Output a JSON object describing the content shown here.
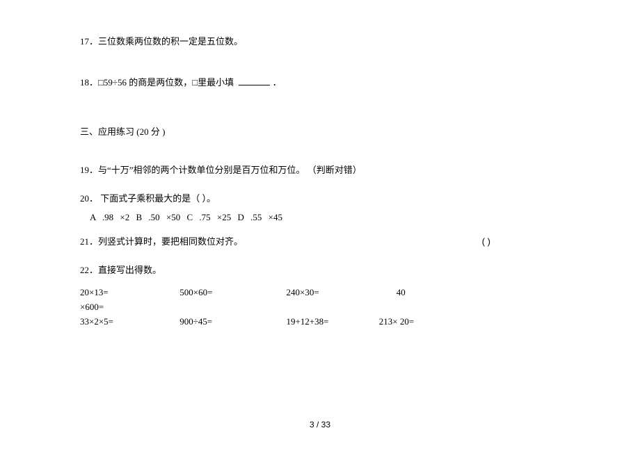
{
  "q17": "17．三位数乘两位数的积一定是五位数。",
  "q18_a": "18．□59÷56 的商是两位数，□里最小填",
  "q18_b": "．",
  "section3": "三、应用练习   (20  分 )",
  "q19": "19．与“十万”相邻的两个计数单位分别是百万位和万位。 （判断对错）",
  "q20": "20． 下面式子乘积最大的是（    ）。",
  "q20_opts": "A .98 ×2    B .50 ×50    C .75 ×25    D .55 ×45",
  "q21_a": "21．列竖式计算时，要把相同数位对齐。",
  "q21_b": "(               )",
  "q22": "22．直接写出得数。",
  "calc_r1_c1": "20×13=",
  "calc_r1_c2": "500×60=",
  "calc_r1_c3": "240×30=",
  "calc_r1_c4": "40",
  "calc_r1b": "×600=",
  "calc_r2_c1": "33×2×5=",
  "calc_r2_c2": "900÷45=",
  "calc_r2_c3": "19+12+38=",
  "calc_r2_c4": "213× 20=",
  "footer": "3 / 33"
}
